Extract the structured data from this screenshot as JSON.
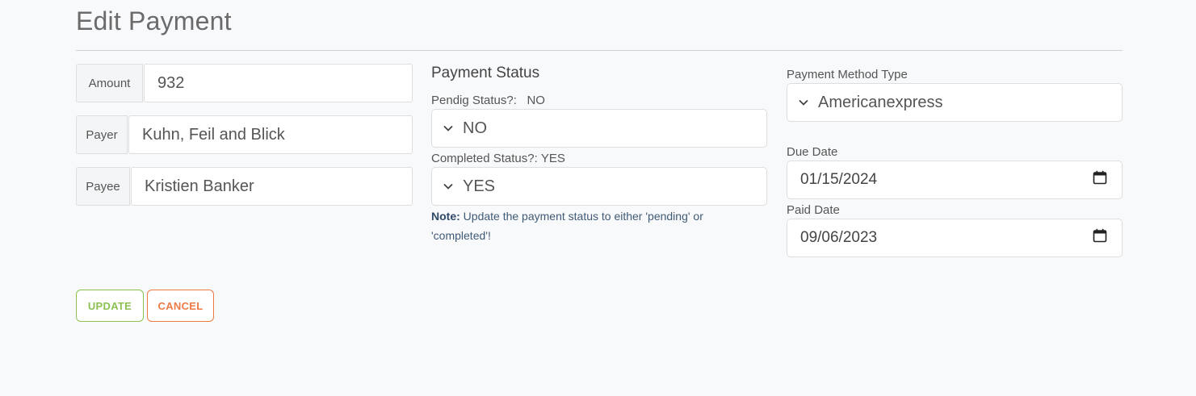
{
  "page": {
    "title": "Edit Payment"
  },
  "fields": {
    "amount": {
      "label": "Amount",
      "value": "932"
    },
    "payer": {
      "label": "Payer",
      "value": "Kuhn, Feil and Blick"
    },
    "payee": {
      "label": "Payee",
      "value": "Kristien Banker"
    }
  },
  "payment_status": {
    "title": "Payment Status",
    "pending_label": "Pendig Status?:",
    "pending_value_text": "NO",
    "pending_select": "NO",
    "completed_label": "Completed Status?:",
    "completed_value_text": "YES",
    "completed_select": "YES",
    "note_prefix": "Note:",
    "note_text": "Update the payment status to either 'pending' or 'completed'!"
  },
  "payment_method": {
    "label": "Payment Method Type",
    "value": "Americanexpress"
  },
  "dates": {
    "due_label": "Due Date",
    "due_value": "01/15/2024",
    "paid_label": "Paid Date",
    "paid_value": "09/06/2023"
  },
  "buttons": {
    "update": "UPDATE",
    "cancel": "CANCEL"
  },
  "colors": {
    "update": "#8cc152",
    "cancel": "#ec7a45",
    "note": "#405a76"
  },
  "icons": {
    "select": "chevron-down-icon",
    "date": "calendar-icon"
  }
}
